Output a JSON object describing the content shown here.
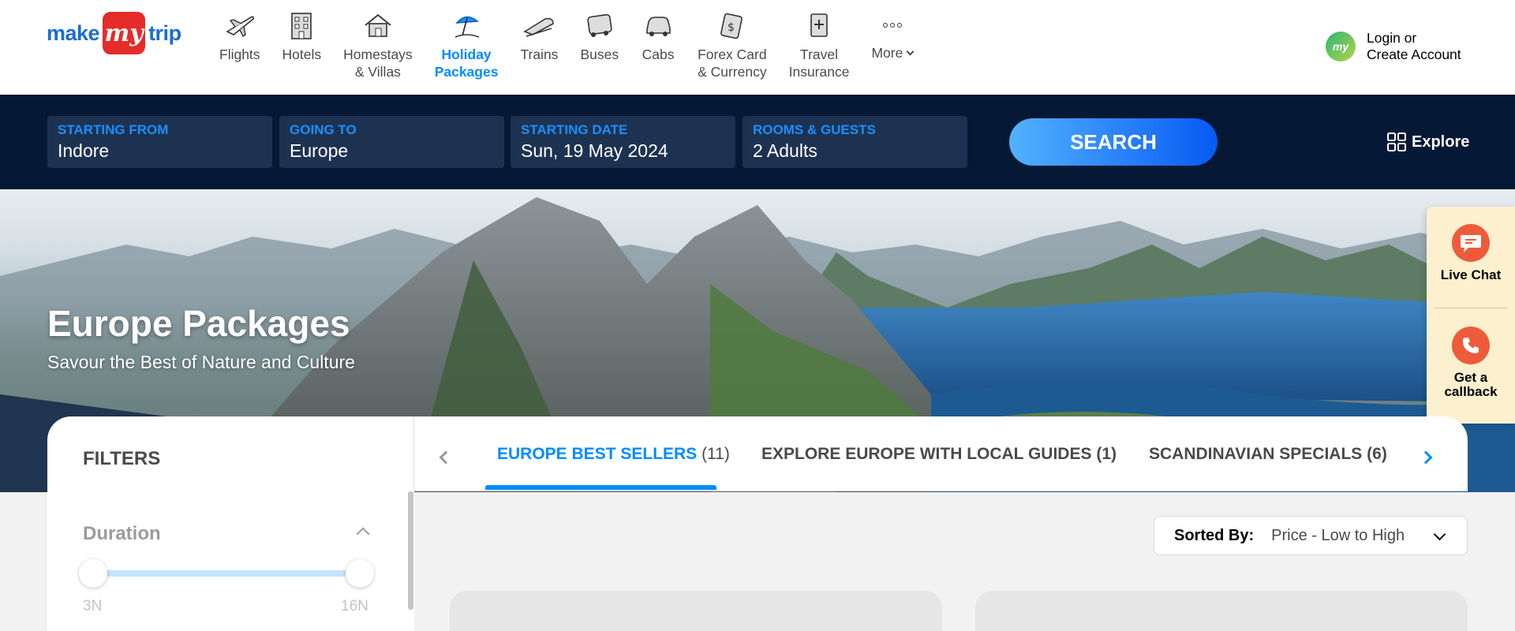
{
  "brand": {
    "part1": "make",
    "part2": "my",
    "part3": "trip"
  },
  "nav": [
    {
      "label": "Flights",
      "icon": "flight-icon"
    },
    {
      "label": "Hotels",
      "icon": "hotel-icon"
    },
    {
      "label": "Homestays\n& Villas",
      "icon": "homestay-icon"
    },
    {
      "label": "Holiday\nPackages",
      "icon": "holiday-package-icon",
      "active": true
    },
    {
      "label": "Trains",
      "icon": "train-icon"
    },
    {
      "label": "Buses",
      "icon": "bus-icon"
    },
    {
      "label": "Cabs",
      "icon": "cab-icon"
    },
    {
      "label": "Forex Card\n& Currency",
      "icon": "forex-icon"
    },
    {
      "label": "Travel\nInsurance",
      "icon": "insurance-icon"
    },
    {
      "label": "More",
      "icon": "more-icon"
    }
  ],
  "account": {
    "avatar": "my",
    "line1": "Login or",
    "line2": "Create Account"
  },
  "search": {
    "from_label": "STARTING FROM",
    "from_value": "Indore",
    "to_label": "GOING TO",
    "to_value": "Europe",
    "date_label": "STARTING DATE",
    "date_value": "Sun, 19 May 2024",
    "guests_label": "ROOMS & GUESTS",
    "guests_value": "2 Adults",
    "button": "SEARCH",
    "explore": "Explore"
  },
  "hero": {
    "title": "Europe Packages",
    "subtitle": "Savour the Best of Nature and Culture"
  },
  "help": {
    "chat": "Live Chat",
    "callback": "Get a\ncallback"
  },
  "filters": {
    "title": "FILTERS",
    "duration_title": "Duration",
    "duration_min": "3N",
    "duration_max": "16N"
  },
  "tabs": [
    {
      "label": "EUROPE BEST SELLERS",
      "count": "(11)",
      "active": true
    },
    {
      "label": "EXPLORE EUROPE WITH LOCAL GUIDES",
      "count": "(1)"
    },
    {
      "label": "SCANDINAVIAN SPECIALS",
      "count": "(6)"
    }
  ],
  "sort": {
    "label": "Sorted By:",
    "value": "Price - Low to High"
  },
  "colors": {
    "brand_blue": "#008cff",
    "dark_navy": "#051937",
    "field_bg": "#1d3251",
    "help_bg": "#fdf0cf",
    "accent_red": "#e62b2b"
  }
}
